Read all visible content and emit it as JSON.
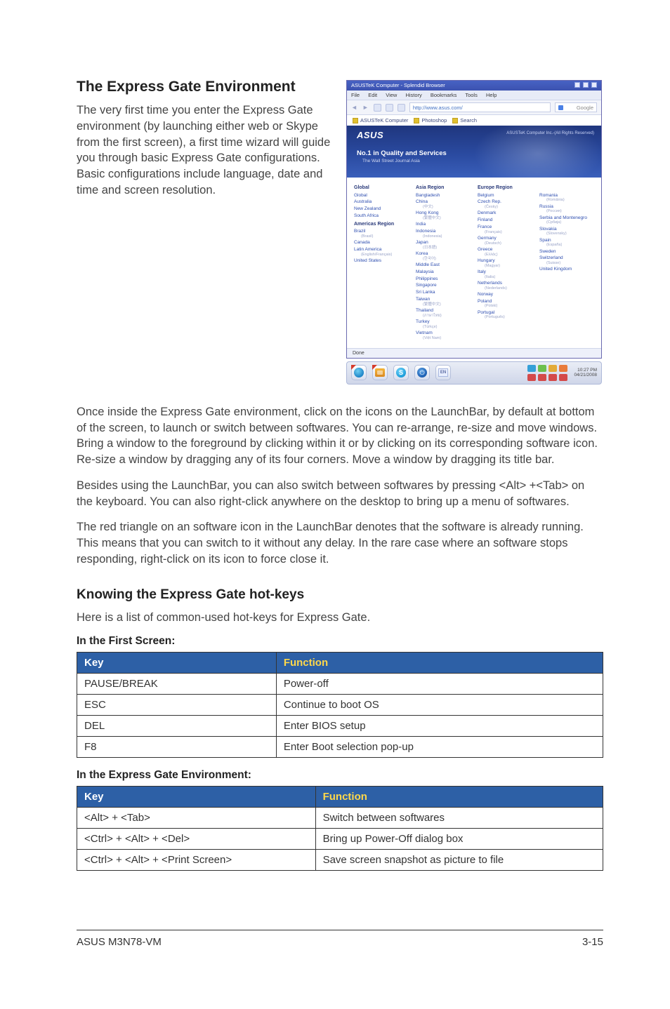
{
  "eg": {
    "heading": "The Express Gate Environment",
    "intro": "The very first time you enter the Express Gate environment (by launching either web or Skype from the first screen), a first time wizard will guide you through basic Express Gate configurations. Basic configurations include language, date and time and screen resolution.",
    "p1": "Once inside the Express Gate environment, click on the icons on the LaunchBar, by default at bottom of the screen, to launch or switch between softwares. You can re-arrange, re-size and move windows. Bring a window to the foreground by clicking within it or by clicking on its corresponding software icon. Re-size a window by dragging any of its four corners. Move a window by dragging its title bar.",
    "p2": "Besides using the LaunchBar, you can also switch between softwares by pressing <Alt> +<Tab> on the keyboard. You can also right-click anywhere on the desktop to bring up a menu of softwares.",
    "p3": "The red triangle on an software icon in the LaunchBar denotes that the software is already running. This means that you can switch to it without any delay. In the rare case where an software stops responding, right-click on its icon to force close it."
  },
  "hotkeys": {
    "heading": "Knowing the Express Gate hot-keys",
    "intro": "Here is a list of common-used hot-keys for Express Gate.",
    "table1_caption": "In the First Screen:",
    "table2_caption": "In the Express Gate Environment:",
    "col_key": "Key",
    "col_func": "Function",
    "table1": [
      {
        "key": "PAUSE/BREAK",
        "func": "Power-off"
      },
      {
        "key": "ESC",
        "func": "Continue to boot OS"
      },
      {
        "key": "DEL",
        "func": "Enter BIOS setup"
      },
      {
        "key": "F8",
        "func": "Enter Boot selection pop-up"
      }
    ],
    "table2": [
      {
        "key": "<Alt> + <Tab>",
        "func": "Switch between softwares"
      },
      {
        "key": "<Ctrl> + <Alt> + <Del>",
        "func": "Bring up Power-Off dialog box"
      },
      {
        "key": "<Ctrl> + <Alt> + <Print Screen>",
        "func": "Save screen snapshot as picture to file"
      }
    ]
  },
  "browserMock": {
    "title": "ASUSTeK Computer - Splendid Browser",
    "menus": [
      "File",
      "Edit",
      "View",
      "History",
      "Bookmarks",
      "Tools",
      "Help"
    ],
    "url": "http://www.asus.com/",
    "searchPlaceholder": "Google",
    "tabs": [
      {
        "label": "ASUSTeK Computer"
      },
      {
        "label": "Photoshop"
      },
      {
        "label": "Search"
      }
    ],
    "hero": {
      "logo": "ASUS",
      "line1": "No.1 in Quality and Services",
      "line2": "The Wall Street Journal Asia",
      "tagline": "ASUSTeK Computer Inc.-(All Rights Reserved)"
    },
    "regions": {
      "col1": {
        "head1": "Global",
        "items1": [
          "Global"
        ],
        "items2": [
          "Australia",
          "New Zealand",
          "South Africa"
        ],
        "head2": "Americas Region",
        "items3": [
          "Brazil",
          "Canada",
          "Latin America",
          "United States"
        ],
        "sub": [
          "(Brasil)",
          "(English/Français)"
        ]
      },
      "col2": {
        "head": "Asia Region",
        "items": [
          "Bangladesh",
          "China",
          "Hong Kong",
          "India",
          "Indonesia",
          "Japan",
          "Korea",
          "Middle East",
          "Malaysia",
          "Philippines",
          "Singapore",
          "Sri Lanka",
          "Taiwan",
          "Thailand",
          "Turkey",
          "Vietnam"
        ],
        "sub": [
          "(繁體中文)",
          "(中文)",
          "(繁體中文)",
          "(Indonesia)",
          "(日本語)",
          "(한국어)",
          "(ภาษาไทย)",
          "(Türkçe)",
          "(Việt Nam)"
        ]
      },
      "col3": {
        "head": "Europe Region",
        "items": [
          "Belgium",
          "Czech Rep.",
          "Denmark",
          "Finland",
          "France",
          "Germany",
          "Greece",
          "Hungary",
          "Italy",
          "Netherlands",
          "Norway",
          "Poland",
          "Portugal"
        ],
        "sub": [
          "(Česky)",
          "(Français)",
          "(Deutsch)",
          "(Ελλάς)",
          "(Magyar)",
          "(Italia)",
          "(Nederlands)",
          "(Polski)",
          "(Português)"
        ]
      },
      "col4": {
        "items": [
          "Romania",
          "Russia",
          "Serbia and Montenegro",
          "Slovakia",
          "Spain",
          "Sweden",
          "Switzerland",
          "United Kingdom"
        ],
        "sub": [
          "(România)",
          "(Россия)",
          "(Србија)",
          "(Slovensky)",
          "(España)",
          "(Suisse)"
        ]
      }
    },
    "status": "Done"
  },
  "launchbar": {
    "buttons": [
      "globe",
      "panel",
      "skype",
      "power",
      "lang"
    ],
    "running": [
      true,
      true,
      false,
      false,
      false
    ],
    "tray_colors": [
      "#35a0d8",
      "#6dc04e",
      "#e3ab39",
      "#e97b3b",
      "#d44a4a",
      "#6a52b9",
      "#e06fa8",
      "#3a9bc4"
    ],
    "clock": {
      "time": "10:27 PM",
      "date": "04/21/2008"
    }
  },
  "footer": {
    "left": "ASUS M3N78-VM",
    "right": "3-15"
  }
}
